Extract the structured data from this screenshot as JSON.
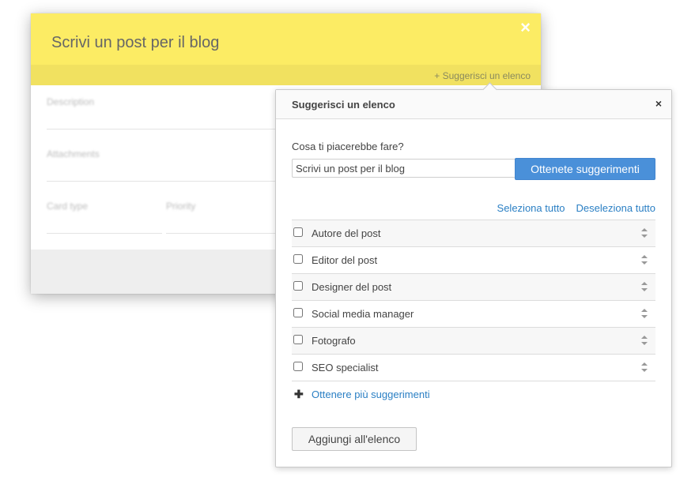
{
  "card": {
    "title": "Scrivi un post per il blog",
    "close_glyph": "×",
    "suggest_link": "+ Suggerisci un elenco",
    "fields": {
      "description_label": "Description",
      "attachments_label": "Attachments",
      "card_type_label": "Card type",
      "priority_label": "Priority"
    },
    "header_color": "#fcec64"
  },
  "popover": {
    "title": "Suggerisci un elenco",
    "close_glyph": "×",
    "question": "Cosa ti piacerebbe fare?",
    "task_input_value": "Scrivi un post per il blog",
    "get_suggestions_label": "Ottenete suggerimenti",
    "select_all": "Seleziona tutto",
    "deselect_all": "Deseleziona tutto",
    "roles": [
      {
        "label": "Autore del post",
        "checked": false
      },
      {
        "label": "Editor del post",
        "checked": false
      },
      {
        "label": "Designer del post",
        "checked": false
      },
      {
        "label": "Social media manager",
        "checked": false
      },
      {
        "label": "Fotografo",
        "checked": false
      },
      {
        "label": "SEO specialist",
        "checked": false
      }
    ],
    "more_icon": "plus-icon",
    "more_label": "Ottenere più suggerimenti",
    "add_button": "Aggiungi all'elenco",
    "accent_color": "#4a90d9",
    "link_color": "#2a7fc4"
  }
}
